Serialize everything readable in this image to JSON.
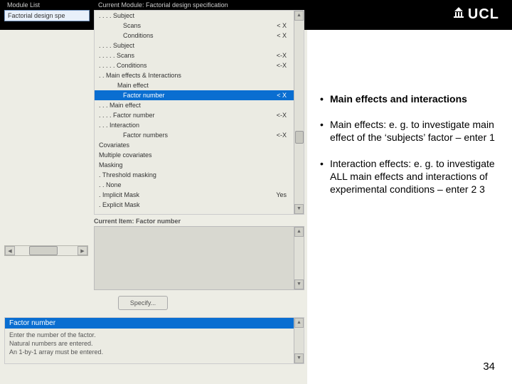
{
  "header": {
    "module_list_label": "Module List",
    "current_module_label": "Current Module: Factorial design specification",
    "logo_text": "UCL"
  },
  "left": {
    "selected": "Factorial design spe"
  },
  "tree": {
    "rows": [
      {
        "label": ". . . . Subject",
        "val": ""
      },
      {
        "label": "Scans",
        "val": "< X",
        "indent": 34
      },
      {
        "label": "Conditions",
        "val": "< X",
        "indent": 34
      },
      {
        "label": ". . . . Subject",
        "val": ""
      },
      {
        "label": ". . . . . Scans",
        "val": "<-X"
      },
      {
        "label": ". . . . . Conditions",
        "val": "<-X"
      },
      {
        "label": ". . Main effects & Interactions",
        "val": ""
      },
      {
        "label": "Main effect",
        "val": "",
        "indent": 26
      },
      {
        "label": "Factor number",
        "val": "< X",
        "selected": true,
        "indent": 34
      },
      {
        "label": ". . . Main effect",
        "val": ""
      },
      {
        "label": ". . . . Factor number",
        "val": "<-X"
      },
      {
        "label": ". . . Interaction",
        "val": ""
      },
      {
        "label": "Factor numbers",
        "val": "<-X",
        "indent": 34
      },
      {
        "label": "Covariates",
        "val": ""
      },
      {
        "label": "Multiple covariates",
        "val": ""
      },
      {
        "label": "Masking",
        "val": ""
      },
      {
        "label": ". Threshold masking",
        "val": ""
      },
      {
        "label": ". . None",
        "val": ""
      },
      {
        "label": ". Implicit Mask",
        "val": "Yes"
      },
      {
        "label": ". Explicit Mask",
        "val": ""
      }
    ]
  },
  "current_item": "Current Item: Factor number",
  "specify_btn": "Specify...",
  "help": {
    "title": "Factor number",
    "line1": "Enter the number of the factor.",
    "line2": "Natural numbers are entered.",
    "line3": "An 1-by-1 array must be entered."
  },
  "bullets": {
    "b1": "Main effects and interactions",
    "b2": "Main effects: e. g. to investigate main effect of the ‘subjects’ factor – enter 1",
    "b3": "Interaction effects: e. g. to investigate ALL main effects and interactions of experimental conditions – enter 2 3"
  },
  "page_num": "34"
}
